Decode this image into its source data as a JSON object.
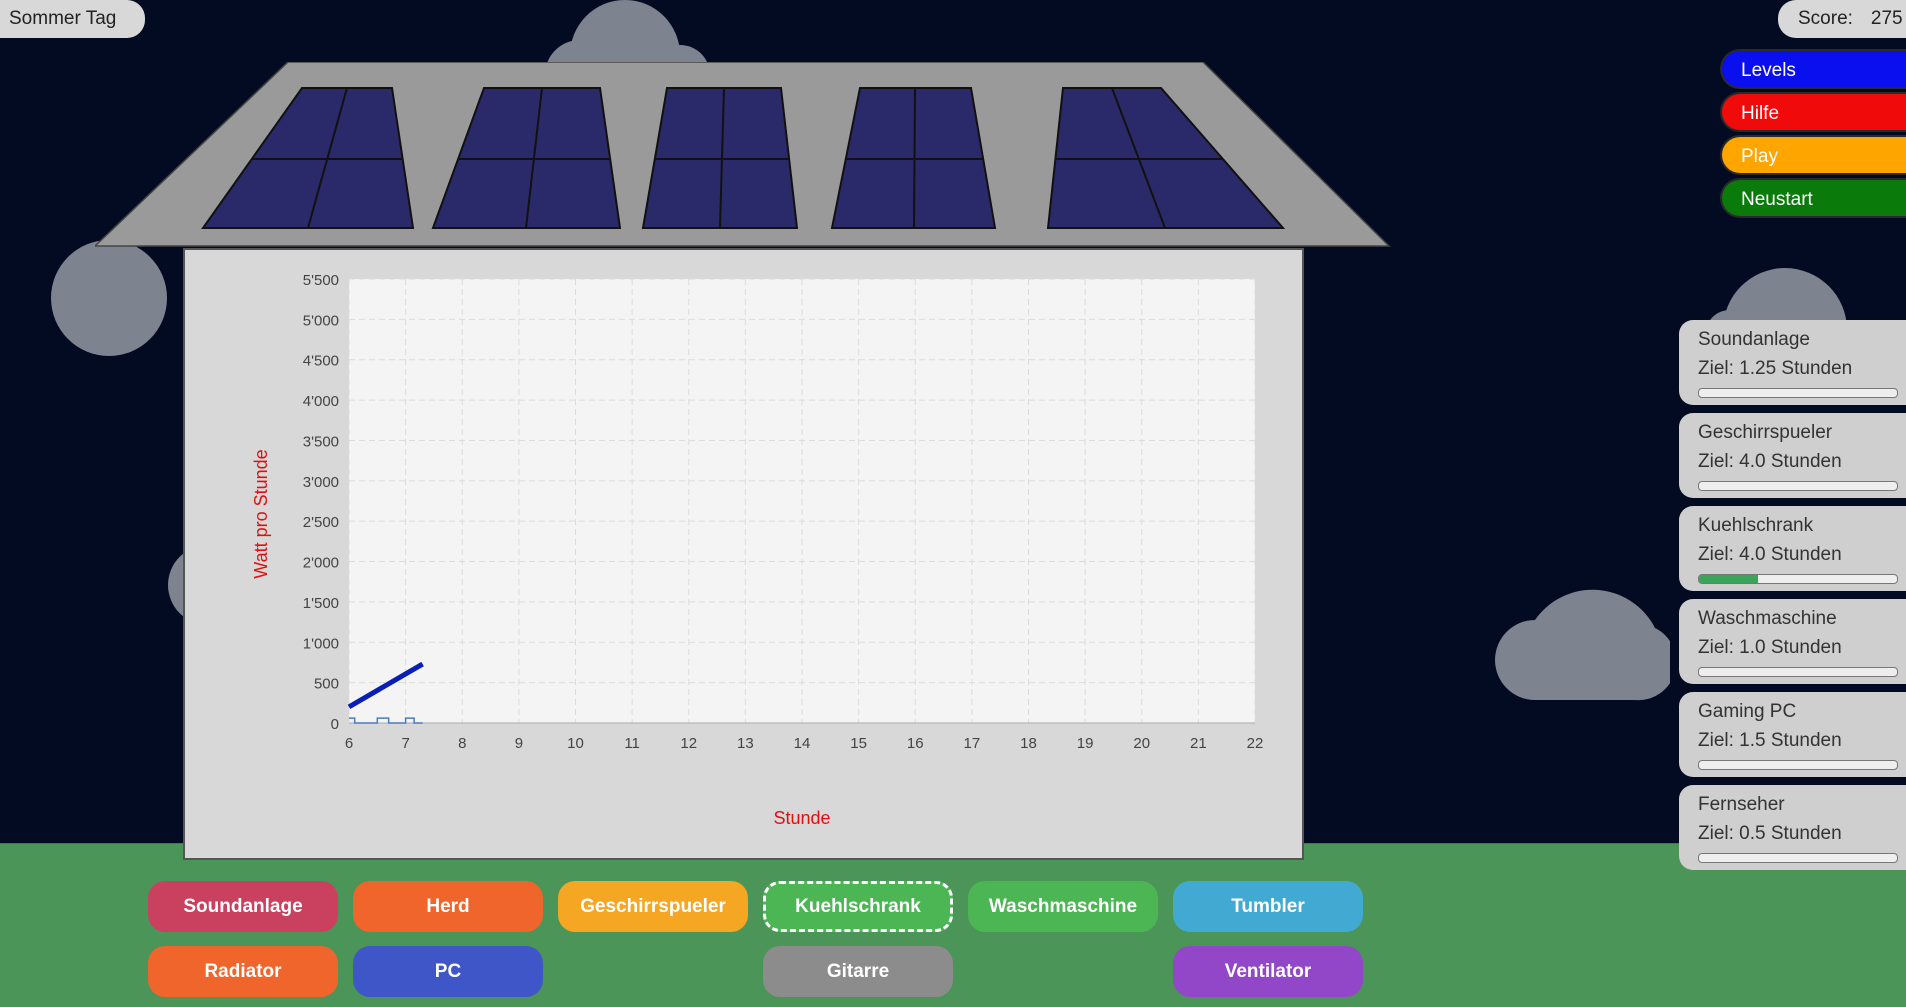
{
  "header": {
    "day_label": "Sommer Tag",
    "score_label": "Score:",
    "score_value": "275"
  },
  "menu": [
    {
      "label": "Levels",
      "color": "#0a0ff0"
    },
    {
      "label": "Hilfe",
      "color": "#f00a0a"
    },
    {
      "label": "Play",
      "color": "#ffa500"
    },
    {
      "label": "Neustart",
      "color": "#0a7a0a"
    }
  ],
  "tasks": [
    {
      "name": "Soundanlage",
      "goal": "Ziel: 1.25 Stunden",
      "progress": 0
    },
    {
      "name": "Geschirrspueler",
      "goal": "Ziel: 4.0 Stunden",
      "progress": 0
    },
    {
      "name": "Kuehlschrank",
      "goal": "Ziel: 4.0 Stunden",
      "progress": 0.3
    },
    {
      "name": "Waschmaschine",
      "goal": "Ziel: 1.0 Stunden",
      "progress": 0
    },
    {
      "name": "Gaming PC",
      "goal": "Ziel: 1.5 Stunden",
      "progress": 0
    },
    {
      "name": "Fernseher",
      "goal": "Ziel: 0.5 Stunden",
      "progress": 0
    }
  ],
  "appliances": [
    {
      "label": "Soundanlage",
      "color": "#c9415f",
      "selected": false
    },
    {
      "label": "Herd",
      "color": "#f0652b",
      "selected": false
    },
    {
      "label": "Geschirrspueler",
      "color": "#f5a623",
      "selected": false
    },
    {
      "label": "Kuehlschrank",
      "color": "#4cb655",
      "selected": true
    },
    {
      "label": "Waschmaschine",
      "color": "#4cb655",
      "selected": false
    },
    {
      "label": "Tumbler",
      "color": "#42a9d2",
      "selected": false
    },
    {
      "label": "Radiator",
      "color": "#f0652b",
      "selected": false
    },
    {
      "label": "PC",
      "color": "#3f56c9",
      "selected": false
    },
    {
      "label": "Gitarre",
      "color": "#8c8c8c",
      "selected": false
    },
    {
      "label": "Ventilator",
      "color": "#9246c8",
      "selected": false
    }
  ],
  "chart_data": {
    "type": "line",
    "xlabel": "Stunde",
    "ylabel": "Watt pro Stunde",
    "xlim": [
      6,
      22
    ],
    "ylim": [
      0,
      5500
    ],
    "x_ticks": [
      "6",
      "7",
      "8",
      "9",
      "10",
      "11",
      "12",
      "13",
      "14",
      "15",
      "16",
      "17",
      "18",
      "19",
      "20",
      "21",
      "22"
    ],
    "y_ticks": [
      "0",
      "500",
      "1'000",
      "1'500",
      "2'000",
      "2'500",
      "3'000",
      "3'500",
      "4'000",
      "4'500",
      "5'000",
      "5'500"
    ],
    "grid": true,
    "series": [
      {
        "values_x": [
          6,
          7.3
        ],
        "values_y": [
          200,
          730
        ],
        "color": "#0a1eb4"
      },
      {
        "values_x": [
          6,
          6.1,
          6.1,
          6.5,
          6.5,
          6.7,
          6.7,
          7.0,
          7.0,
          7.15,
          7.15,
          7.3
        ],
        "values_y": [
          60,
          60,
          0,
          0,
          60,
          60,
          0,
          0,
          60,
          60,
          0,
          0
        ],
        "color": "#4a7ac0"
      }
    ]
  }
}
